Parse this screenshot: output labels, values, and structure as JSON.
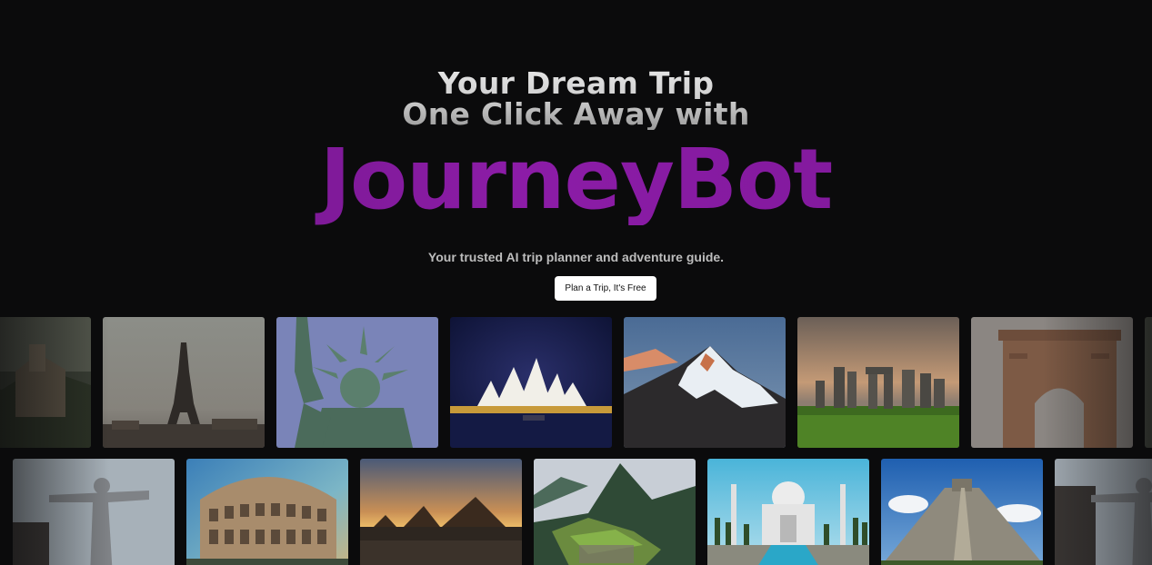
{
  "hero": {
    "headline_line1": "Your Dream Trip",
    "headline_line2": "One Click Away with",
    "brand": "JourneyBot",
    "subtitle": "Your trusted AI trip planner and adventure guide.",
    "cta_label": "Plan a Trip, It's Free"
  },
  "colors": {
    "background": "#0b0b0c",
    "brand_purple": "#8c1ca7",
    "cta_background": "#ffffff"
  },
  "gallery": {
    "row1": [
      "great-wall",
      "eiffel-tower",
      "statue-of-liberty",
      "sydney-opera-house",
      "mount-everest",
      "stonehenge",
      "india-gate"
    ],
    "row2": [
      "christ-the-redeemer",
      "colosseum",
      "pyramids-of-giza",
      "machu-picchu",
      "taj-mahal",
      "chichen-itza",
      "christ-the-redeemer"
    ]
  }
}
